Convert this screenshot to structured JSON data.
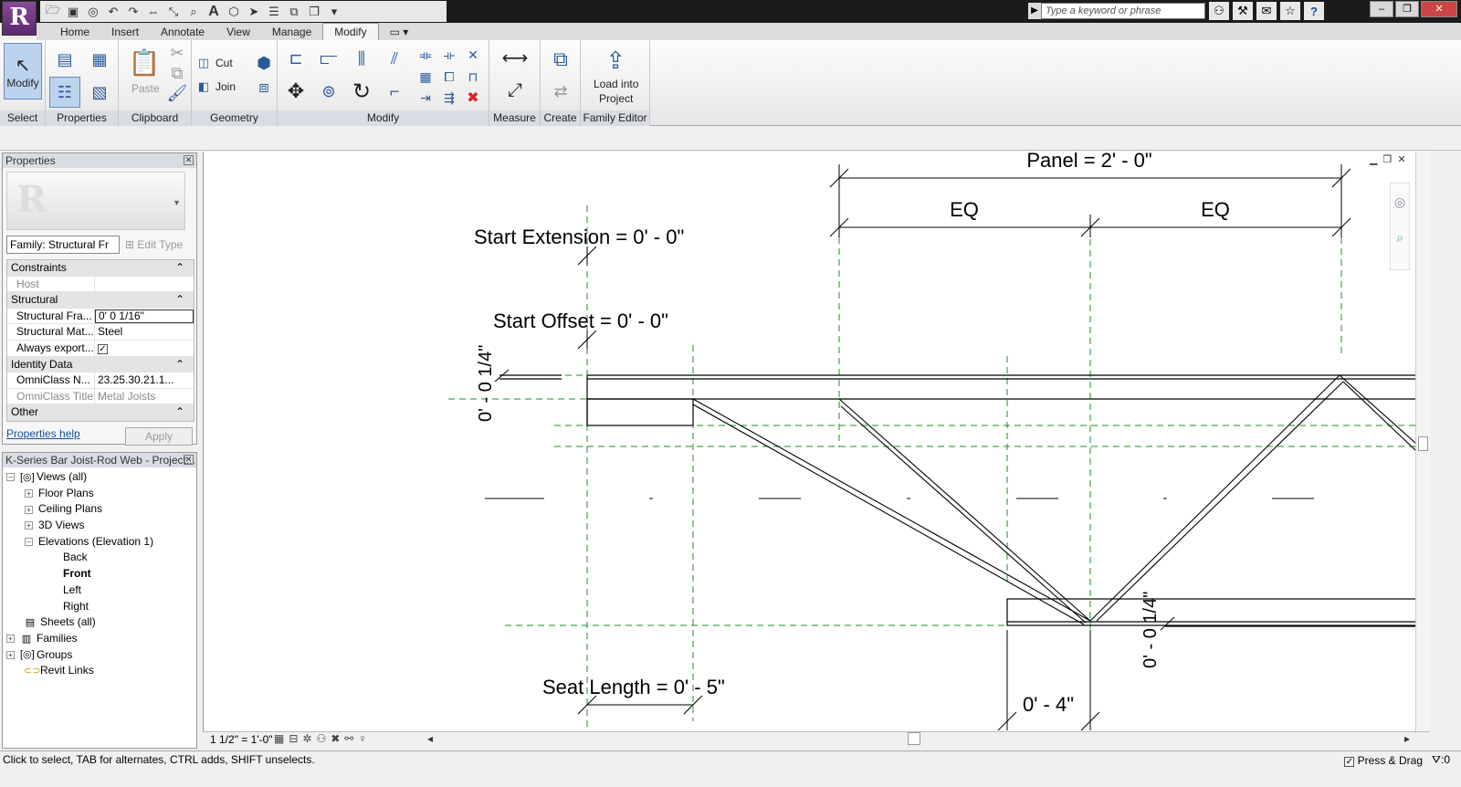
{
  "search": {
    "placeholder": "Type a keyword or phrase"
  },
  "app": {
    "letter": "R"
  },
  "tabs": [
    "Home",
    "Insert",
    "Annotate",
    "View",
    "Manage",
    "Modify"
  ],
  "ribbon": {
    "modify_label": "Modify",
    "paste_label": "Paste",
    "cut_label": "Cut",
    "join_label": "Join",
    "load_line1": "Load into",
    "load_line2": "Project",
    "panels": [
      "Select",
      "Properties",
      "Clipboard",
      "Geometry",
      "Modify",
      "Measure",
      "Create",
      "Family Editor"
    ]
  },
  "properties": {
    "title": "Properties",
    "family_select": "Family: Structural Fr",
    "edit_type": "Edit Type",
    "categories": {
      "constraints": "Constraints",
      "structural": "Structural",
      "identity": "Identity Data",
      "other": "Other"
    },
    "rows": {
      "host_k": "Host",
      "host_v": "",
      "sf_k": "Structural Fra...",
      "sf_v": "0'  0 1/16\"",
      "sm_k": "Structural Mat...",
      "sm_v": "Steel",
      "ae_k": "Always export...",
      "ae_v": "✓",
      "ocn_k": "OmniClass N...",
      "ocn_v": "23.25.30.21.1...",
      "oct_k": "OmniClass Title",
      "oct_v": "Metal Joists"
    },
    "help": "Properties help",
    "apply": "Apply"
  },
  "browser": {
    "title": "K-Series Bar Joist-Rod Web - Project...",
    "items": {
      "views": "Views (all)",
      "floor": "Floor Plans",
      "ceiling": "Ceiling Plans",
      "threed": "3D Views",
      "elev": "Elevations (Elevation 1)",
      "back": "Back",
      "front": "Front",
      "left": "Left",
      "right": "Right",
      "sheets": "Sheets (all)",
      "families": "Families",
      "groups": "Groups",
      "links": "Revit Links"
    }
  },
  "drawing": {
    "panel": "Panel = 2' - 0\"",
    "eq1": "EQ",
    "eq2": "EQ",
    "start_ext": "Start Extension = 0' - 0\"",
    "start_off": "Start Offset = 0' - 0\"",
    "dim_left": "0' - 0 1/4\"",
    "dim_right": "0' - 0 1/4\"",
    "seat": "Seat Length = 0' - 5\"",
    "bottom": "0' - 4\""
  },
  "view_control": {
    "scale": "1 1/2\" = 1'-0\""
  },
  "status": {
    "message": "Click to select, TAB for alternates, CTRL adds, SHIFT unselects.",
    "press_drag": "Press & Drag",
    "filter": ":0"
  },
  "colors": {
    "ref_plane": "#1f8f1f",
    "ribbon_active": "#bcd3ee"
  }
}
